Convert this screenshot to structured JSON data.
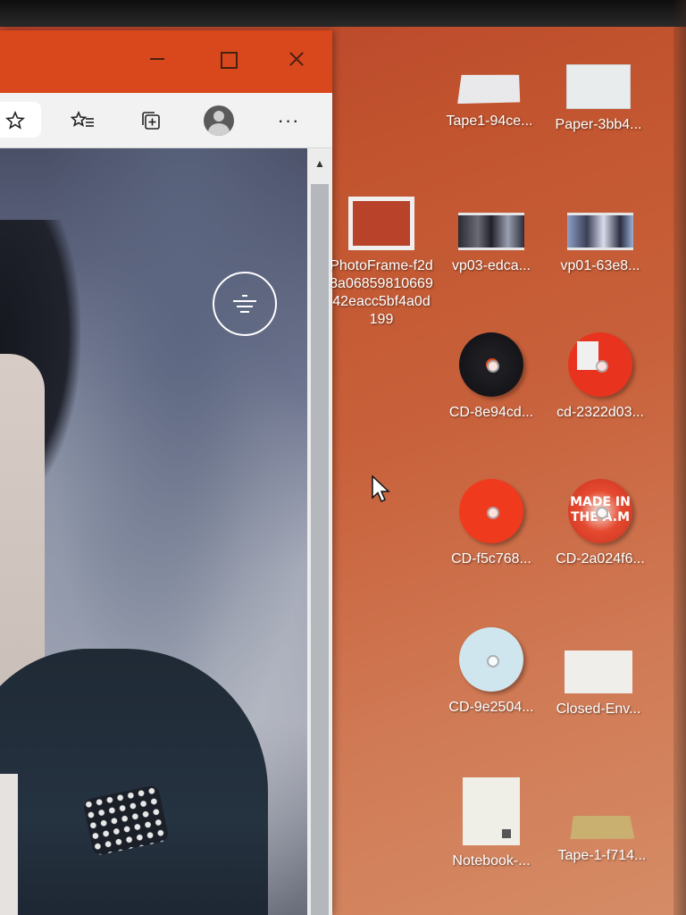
{
  "browser": {
    "toolbar": {
      "favorite_icon": "star-plus-icon",
      "favorites_icon": "favorites-list-icon",
      "collections_icon": "collections-icon",
      "profile_icon": "profile-avatar-icon",
      "more_label": "···"
    },
    "titlebar": {
      "minimize_icon": "minimize-icon",
      "maximize_icon": "maximize-icon",
      "close_icon": "close-icon"
    },
    "content": {
      "overlay_icon": "visual-search-icon"
    },
    "scrollbar": {
      "up_arrow": "▲"
    }
  },
  "desktop": {
    "icons": [
      {
        "label": "Tape1-94ce...",
        "type": "tape"
      },
      {
        "label": "Paper-3bb4...",
        "type": "paper"
      },
      {
        "label": "PhotoFrame-f2d8a0685981066942eacc5bf4a0d199",
        "type": "frame"
      },
      {
        "label": "vp03-edca...",
        "type": "video"
      },
      {
        "label": "vp01-63e8...",
        "type": "video"
      },
      {
        "label": "CD-8e94cd...",
        "type": "cd"
      },
      {
        "label": "cd-2322d03...",
        "type": "cd"
      },
      {
        "label": "CD-f5c768...",
        "type": "cd"
      },
      {
        "label": "CD-2a024f6...",
        "type": "cd"
      },
      {
        "label": "CD-9e2504...",
        "type": "cd"
      },
      {
        "label": "Closed-Env...",
        "type": "envelope"
      },
      {
        "label": "Notebook-...",
        "type": "notebook"
      },
      {
        "label": "Tape-1-f714...",
        "type": "tape"
      }
    ],
    "cd_art_text": "MADE IN THE A.M"
  }
}
